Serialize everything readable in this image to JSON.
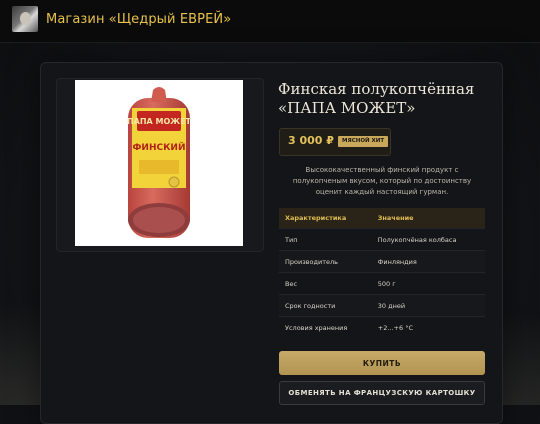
{
  "header": {
    "store_title": "Магазин «Щедрый ЕВРЕЙ»"
  },
  "product": {
    "name": "Финская полукопчённая «ПАПА МОЖЕТ»",
    "price": "3 000 ₽",
    "badge": "МЯСНОЙ ХИТ",
    "description": "Высококачественный финский продукт с полукопченым вкусом, который по достоинству оценит каждый настоящий гурман.",
    "package_brand": "ПАПА МОЖЕТ",
    "package_variety": "ФИНСКИЙ"
  },
  "specs": {
    "headers": [
      "Характеристика",
      "Значение"
    ],
    "rows": [
      [
        "Тип",
        "Полукопчёная колбаса"
      ],
      [
        "Производитель",
        "Финляндия"
      ],
      [
        "Вес",
        "500 г"
      ],
      [
        "Срок годности",
        "30 дней"
      ],
      [
        "Условия хранения",
        "+2...+6 °C"
      ]
    ]
  },
  "actions": {
    "buy_label": "КУПИТЬ",
    "swap_label": "ОБМЕНЯТЬ НА ФРАНЦУЗСКУЮ КАРТОШКУ"
  }
}
